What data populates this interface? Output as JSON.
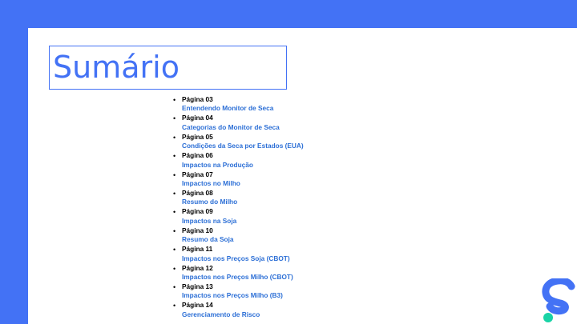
{
  "title": "Sumário",
  "bullet": "•",
  "toc": [
    {
      "page": "Página 03",
      "section": "Entendendo Monitor de Seca"
    },
    {
      "page": "Página 04",
      "section": "Categorias do Monitor de Seca"
    },
    {
      "page": "Página 05",
      "section": "Condições da Seca por Estados (EUA)"
    },
    {
      "page": "Página 06",
      "section": "Impactos na Produção"
    },
    {
      "page": "Página 07",
      "section": "Impactos no Milho"
    },
    {
      "page": "Página 08",
      "section": "Resumo do Milho"
    },
    {
      "page": "Página 09",
      "section": "Impactos na Soja"
    },
    {
      "page": "Página 10",
      "section": "Resumo da Soja"
    },
    {
      "page": "Página 11",
      "section": "Impactos nos Preços Soja (CBOT)"
    },
    {
      "page": "Página 12",
      "section": "Impactos nos Preços Milho (CBOT)"
    },
    {
      "page": "Página 13",
      "section": "Impactos nos Preços Milho (B3)"
    },
    {
      "page": "Página 14",
      "section": "Gerenciamento de Risco"
    }
  ],
  "colors": {
    "background": "#4372f5",
    "accent": "#4372f5",
    "link": "#2c6fd6",
    "logo_dot": "#19d3a6"
  },
  "logo": {
    "icon": "brand-s-logo-icon"
  }
}
